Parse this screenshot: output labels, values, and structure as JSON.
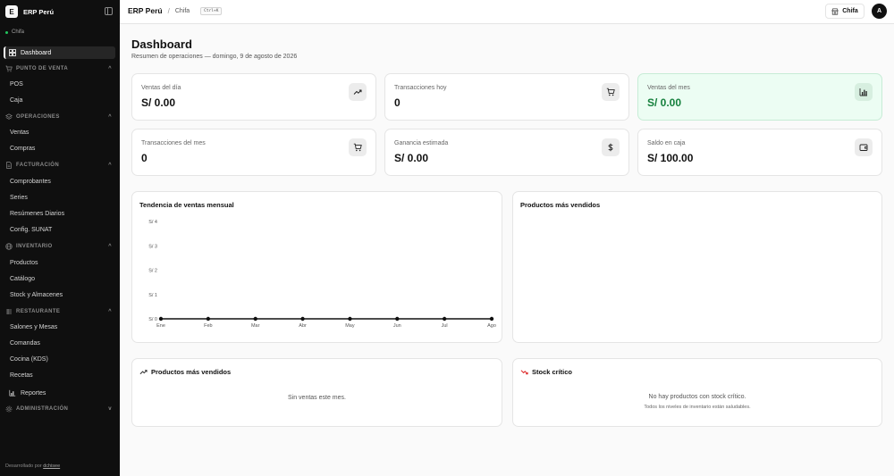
{
  "sidebar": {
    "brand_letter": "E",
    "brand_name": "ERP Perú",
    "branch": "Chifa",
    "dashboard_label": "Dashboard",
    "sections": {
      "pos": {
        "title": "PUNTO DE VENTA",
        "items": [
          "POS",
          "Caja"
        ]
      },
      "ops": {
        "title": "OPERACIONES",
        "items": [
          "Ventas",
          "Compras"
        ]
      },
      "billing": {
        "title": "FACTURACIÓN",
        "items": [
          "Comprobantes",
          "Series",
          "Resúmenes Diarios",
          "Config. SUNAT"
        ]
      },
      "inventory": {
        "title": "INVENTARIO",
        "items": [
          "Productos",
          "Catálogo",
          "Stock y Almacenes"
        ]
      },
      "restaurant": {
        "title": "RESTAURANTE",
        "items": [
          "Salones y Mesas",
          "Comandas",
          "Cocina (KDS)",
          "Recetas"
        ]
      },
      "admin": {
        "title": "ADMINISTRACIÓN"
      }
    },
    "reports_label": "Reportes",
    "footer_prefix": "Desarrollado por ",
    "footer_link": "dchisee"
  },
  "topbar": {
    "app_name": "ERP Perú",
    "separator": "/",
    "current": "Chifa",
    "shortcut": "Ctrl+K",
    "branch_button": "Chifa",
    "avatar_letter": "A"
  },
  "main": {
    "title": "Dashboard",
    "subtitle": "Resumen de operaciones — domingo, 9 de agosto de 2026",
    "stats": [
      {
        "label": "Ventas del día",
        "value": "S/ 0.00",
        "icon": "trending-up-icon"
      },
      {
        "label": "Transacciones hoy",
        "value": "0",
        "icon": "cart-icon"
      },
      {
        "label": "Ventas del mes",
        "value": "S/ 0.00",
        "icon": "bar-chart-icon",
        "accent": "#15803d"
      },
      {
        "label": "Transacciones del mes",
        "value": "0",
        "icon": "cart-icon"
      },
      {
        "label": "Ganancia estimada",
        "value": "S/ 0.00",
        "icon": "dollar-icon"
      },
      {
        "label": "Saldo en caja",
        "value": "S/ 100.00",
        "icon": "wallet-icon"
      }
    ],
    "trend_panel": {
      "title": "Tendencia de ventas mensual"
    },
    "top_chart_panel": {
      "title": "Productos más vendidos"
    },
    "top_products": {
      "title": "Productos más vendidos",
      "empty": "Sin ventas este mes."
    },
    "stock": {
      "title": "Stock crítico",
      "empty": "No hay productos con stock crítico.",
      "empty_sub": "Todos los niveles de inventario están saludables."
    }
  },
  "chart_data": {
    "type": "line",
    "title": "Tendencia de ventas mensual",
    "categories": [
      "Ene",
      "Feb",
      "Mar",
      "Abr",
      "May",
      "Jun",
      "Jul",
      "Ago"
    ],
    "y_tick_labels": [
      "S/ 0",
      "S/ 1",
      "S/ 2",
      "S/ 3",
      "S/ 4"
    ],
    "series": [
      {
        "values": [
          0,
          0,
          0,
          0,
          0,
          0,
          0,
          0
        ]
      }
    ],
    "ylim": [
      0,
      4
    ],
    "grid": false,
    "line_color": "#111111"
  }
}
